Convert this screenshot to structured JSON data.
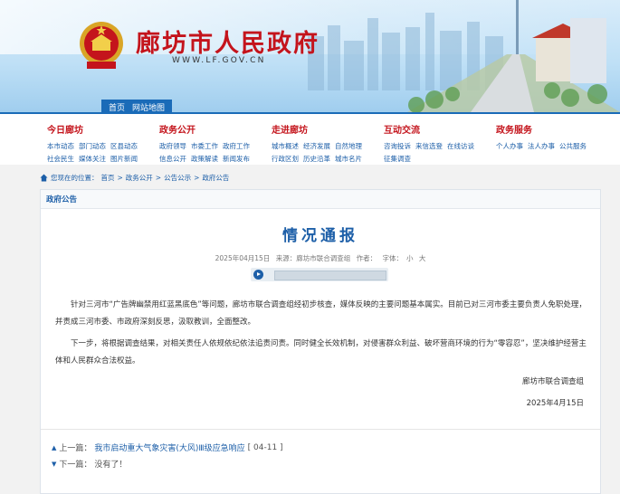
{
  "header": {
    "site_title": "廊坊市人民政府",
    "site_url": "WWW.LF.GOV.CN",
    "top_links": [
      "首页",
      "网站地图"
    ]
  },
  "nav": [
    {
      "title": "今日廊坊",
      "rows": [
        [
          "本市动态",
          "部门动态",
          "区县动态"
        ],
        [
          "社会民生",
          "媒体关注",
          "图片新闻"
        ]
      ]
    },
    {
      "title": "政务公开",
      "rows": [
        [
          "政府领导",
          "市委工作",
          "政府工作"
        ],
        [
          "信息公开",
          "政策解读",
          "新闻发布"
        ]
      ]
    },
    {
      "title": "走进廊坊",
      "rows": [
        [
          "城市概述",
          "经济发展",
          "自然地理"
        ],
        [
          "行政区划",
          "历史沿革",
          "城市名片"
        ]
      ]
    },
    {
      "title": "互动交流",
      "rows": [
        [
          "咨询投诉",
          "来信选登",
          "在线访谈"
        ],
        [
          "征集调查"
        ]
      ]
    },
    {
      "title": "政务服务",
      "rows": [
        [
          "个人办事",
          "法人办事",
          "公共服务"
        ]
      ]
    }
  ],
  "breadcrumb": {
    "prefix": "您现在的位置：",
    "items": [
      "首页",
      "政务公开",
      "公告公示",
      "政府公告"
    ],
    "sep": ">"
  },
  "panel": {
    "category": "政府公告",
    "title": "情况通报",
    "date": "2025年04月15日",
    "source": "来源：廊坊市联合调查组",
    "author": "作者：",
    "font_label": "字体：",
    "font_small": "小",
    "font_large": "大",
    "paragraphs": [
      "针对三河市“广告牌幽禁用红蓝黑底色”等问题，廊坊市联合调查组经初步核查，媒体反映的主要问题基本属实。目前已对三河市委主要负责人免职处理，并责成三河市委、市政府深刻反思，汲取教训，全面整改。",
      "下一步，将根据调查结果，对相关责任人依规依纪依法追责问责。同时健全长效机制，对侵害群众利益、破坏营商环境的行为“零容忍”，坚决维护经营主体和人民群众合法权益。"
    ],
    "signature": "廊坊市联合调查组",
    "sign_date": "2025年4月15日"
  },
  "prev": {
    "label": "上一篇：",
    "text": "我市启动重大气象灾害(大风)Ⅲ级应急响应",
    "date": "[ 04-11 ]"
  },
  "next": {
    "label": "下一篇：",
    "text": "没有了！"
  },
  "colors": {
    "accent": "#1d5fa8",
    "brand_red": "#c4141c"
  }
}
